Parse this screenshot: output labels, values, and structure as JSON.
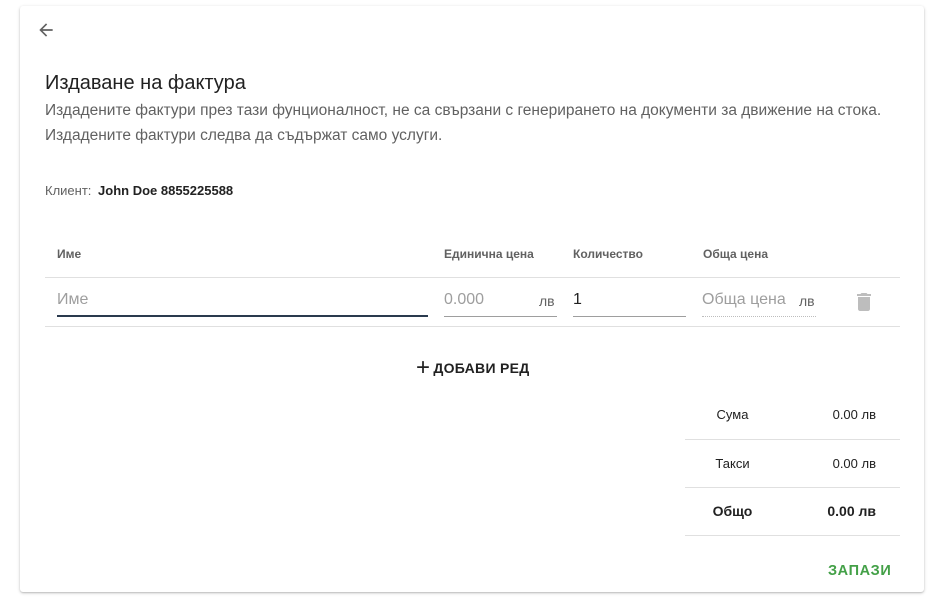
{
  "header": {
    "title": "Издаване на фактура",
    "subtitle": "Издадените фактури през тази фунционалност, не са свързани с генерирането на документи за движение на стока. Издадените фактури следва да съдържат само услуги."
  },
  "client": {
    "label": "Клиент:",
    "value": "John Doe 8855225588"
  },
  "table": {
    "columns": [
      "Име",
      "Единична цена",
      "Количество",
      "Обща цена"
    ],
    "row": {
      "name": {
        "value": "",
        "placeholder": "Име"
      },
      "unit_price": {
        "value": "",
        "placeholder": "0.000",
        "suffix": "лв"
      },
      "quantity": {
        "value": "1"
      },
      "total": {
        "value": "",
        "placeholder": "Обща цена",
        "suffix": "лв"
      }
    }
  },
  "add_row_label": "ДОБАВИ РЕД",
  "summary": {
    "sum": {
      "label": "Сума",
      "value": "0.00 лв"
    },
    "taxes": {
      "label": "Такси",
      "value": "0.00 лв"
    },
    "total": {
      "label": "Общо",
      "value": "0.00 лв"
    }
  },
  "save_label": "ЗАПАЗИ",
  "icons": {
    "back": "arrow-back-icon",
    "add": "plus-icon",
    "delete": "trash-icon"
  },
  "colors": {
    "accent": "#43a047",
    "focus": "#2a3a4e"
  }
}
